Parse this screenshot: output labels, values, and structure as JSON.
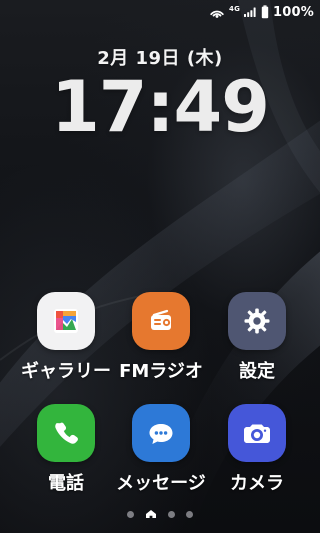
{
  "status_bar": {
    "network_label": "4G",
    "battery_percent": "100%",
    "icons": [
      "hotspot-icon",
      "cellular-signal-icon",
      "battery-icon"
    ]
  },
  "lock_screen": {
    "date": "2月 19日 (木)",
    "time": "17:49"
  },
  "apps": [
    {
      "label": "ギャラリー",
      "icon": "gallery-icon",
      "color": "#f2f2f3"
    },
    {
      "label": "FMラジオ",
      "icon": "radio-icon",
      "color": "#e6782f"
    },
    {
      "label": "設定",
      "icon": "gear-icon",
      "color": "#4f5672"
    },
    {
      "label": "電話",
      "icon": "phone-icon",
      "color": "#33b53d"
    },
    {
      "label": "メッセージ",
      "icon": "chat-bubble-icon",
      "color": "#2d79d7"
    },
    {
      "label": "カメラ",
      "icon": "camera-icon",
      "color": "#4557d9"
    }
  ],
  "page_indicator": {
    "page_count": 4,
    "current_page": 2,
    "current_marker": "home-icon"
  }
}
